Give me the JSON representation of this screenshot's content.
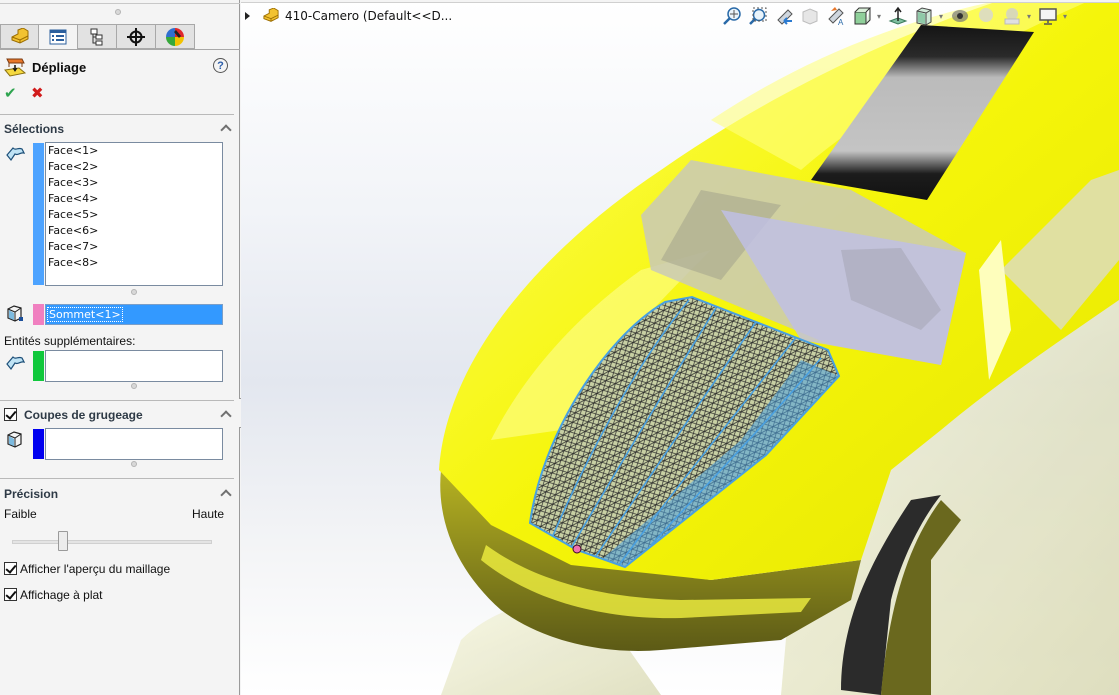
{
  "panel": {
    "tabs": [
      {
        "name": "featuremanager",
        "icon": "part-icon"
      },
      {
        "name": "propertymanager",
        "icon": "property-list-icon",
        "active": true
      },
      {
        "name": "configurationmanager",
        "icon": "configuration-tree-icon"
      },
      {
        "name": "dimxpertmanager",
        "icon": "crosshair-icon"
      },
      {
        "name": "displaymanager",
        "icon": "appearance-ball-icon"
      }
    ],
    "title": "Dépliage",
    "help_glyph": "?",
    "ok_glyph": "✔",
    "cancel_glyph": "✖",
    "selections": {
      "title": "Sélections",
      "faces": [
        "Face<1>",
        "Face<2>",
        "Face<3>",
        "Face<4>",
        "Face<5>",
        "Face<6>",
        "Face<7>",
        "Face<8>"
      ],
      "faces_color": "#4da3ff",
      "vertex": "Sommet<1>",
      "vertex_color": "#f080c0",
      "additional_label": "Entités supplémentaires:",
      "additional_value": "",
      "additional_color": "#10c83c"
    },
    "relief_cuts": {
      "title": "Coupes de grugeage",
      "checked": true,
      "value": "",
      "color": "#0000f0"
    },
    "precision": {
      "title": "Précision",
      "low_label": "Faible",
      "high_label": "Haute",
      "value_fraction": 0.24
    },
    "options": [
      {
        "label": "Afficher l'aperçu du maillage",
        "checked": true
      },
      {
        "label": "Affichage à plat",
        "checked": true
      }
    ]
  },
  "viewport": {
    "tree_root": "410-Camero  (Default<<D...",
    "hud_buttons": [
      "zoom-to-fit-icon",
      "zoom-to-area-icon",
      "previous-view-icon",
      "section-view-icon",
      "dynamic-annotation-views-icon",
      "view-orientation-icon",
      "display-style-normal-icon",
      "hide-show-items-icon",
      "edit-appearance-icon",
      "apply-scene-icon",
      "view-settings-icon",
      "monitor-icon"
    ],
    "colors": {
      "body": "#f5f50a",
      "mesh_outline": "#4aa0e0",
      "stripe": "#1a1a1a",
      "glass": "#c8c8e8",
      "vertex_marker": "#f070b0"
    }
  }
}
